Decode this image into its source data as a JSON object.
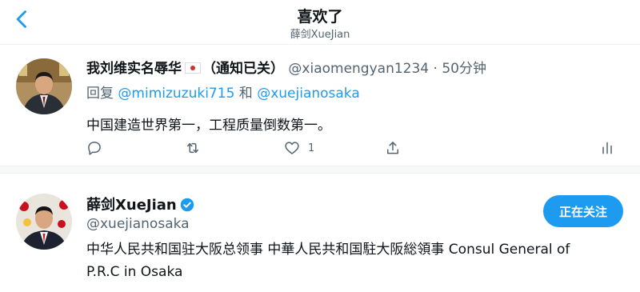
{
  "header": {
    "title": "喜欢了",
    "subtitle": "薛剑XueJian"
  },
  "tweet": {
    "author_name": "我刘维实名辱华",
    "author_suffix": "（通知已关）",
    "handle": "@xiaomengyan1234",
    "separator": "·",
    "time": "50分钟",
    "reply_prefix": "回复",
    "reply_to_1": "@mimizuzuki715",
    "reply_joiner": "和",
    "reply_to_2": "@xuejianosaka",
    "text": "中国建造世界第一，工程质量倒数第一。",
    "actions": {
      "reply_icon": "reply-icon",
      "retweet_icon": "retweet-icon",
      "like_icon": "heart-icon",
      "like_count": "1",
      "share_icon": "share-icon",
      "analytics_icon": "analytics-icon"
    }
  },
  "user": {
    "name": "薛剑XueJian",
    "handle": "@xuejianosaka",
    "bio": "中华人民共和国驻大阪总领事 中華人民共和国駐大阪総領事 Consul General of P.R.C in Osaka",
    "follow_label": "正在关注"
  },
  "colors": {
    "accent": "#1d9bf0",
    "muted": "#536471",
    "text": "#0f1419"
  }
}
